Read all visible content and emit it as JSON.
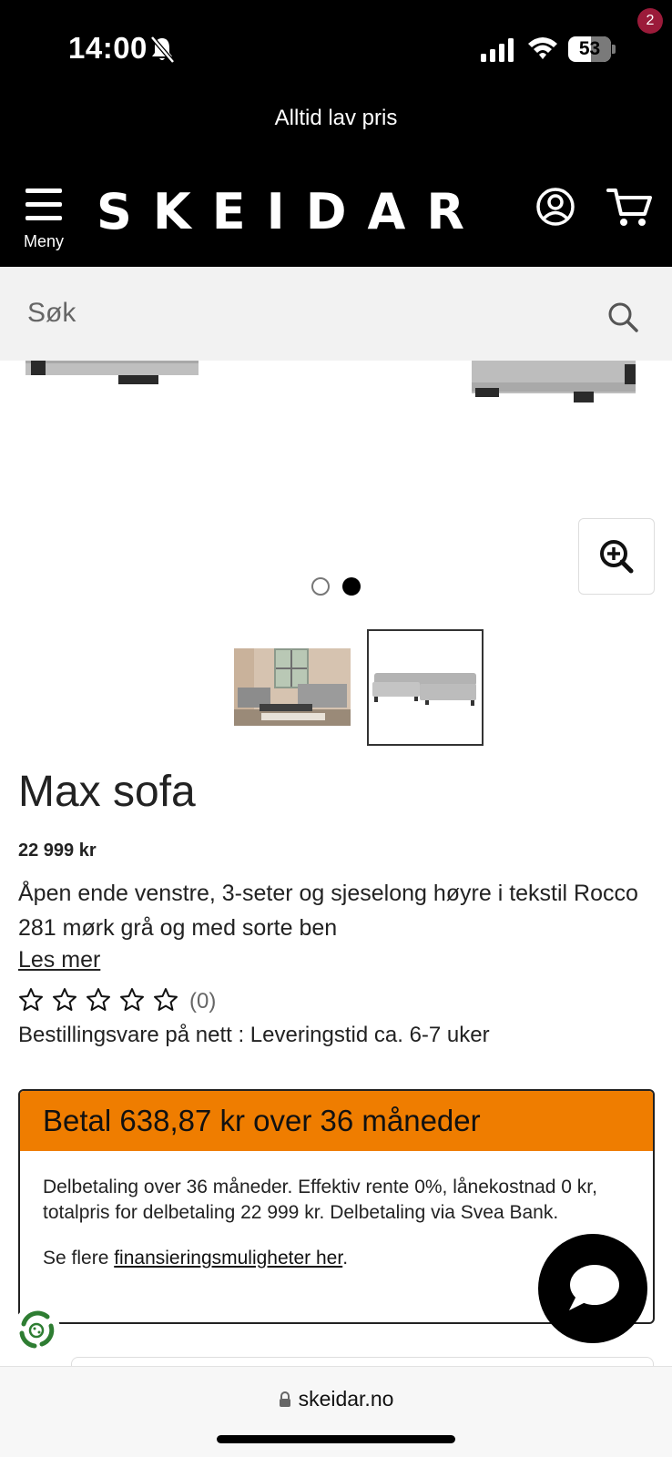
{
  "status_bar": {
    "time": "14:00",
    "battery": "53"
  },
  "promo": {
    "text": "Alltid lav pris"
  },
  "header": {
    "menu_label": "Meny",
    "logo": "SKEIDAR",
    "cart_count": "2"
  },
  "search": {
    "placeholder": "Søk"
  },
  "gallery": {
    "image_count": 2,
    "active_index": 2
  },
  "product": {
    "title": "Max sofa",
    "price": "22 999 kr",
    "description": "Åpen ende venstre, 3-seter og sjeselong høyre i tekstil Rocco 281 mørk grå og med sorte ben",
    "read_more": "Les mer",
    "rating_value": 0,
    "rating_count": "(0)",
    "delivery": "Bestillingsvare på nett : Leveringstid ca. 6-7 uker"
  },
  "financing": {
    "headline": "Betal 638,87 kr over 36 måneder",
    "body": "Delbetaling over 36 måneder. Effektiv rente 0%, lånekostnad 0 kr, totalpris for delbetaling 22 999 kr. Delbetaling via Svea Bank.",
    "more_prefix": "Se flere ",
    "more_link": "finansieringsmuligheter her",
    "more_suffix": "."
  },
  "browser": {
    "url": "skeidar.no"
  },
  "colors": {
    "brand_black": "#000000",
    "finance_orange": "#ef7d00",
    "cart_badge": "#9b1b3a",
    "search_bg": "#f2f2f2"
  }
}
